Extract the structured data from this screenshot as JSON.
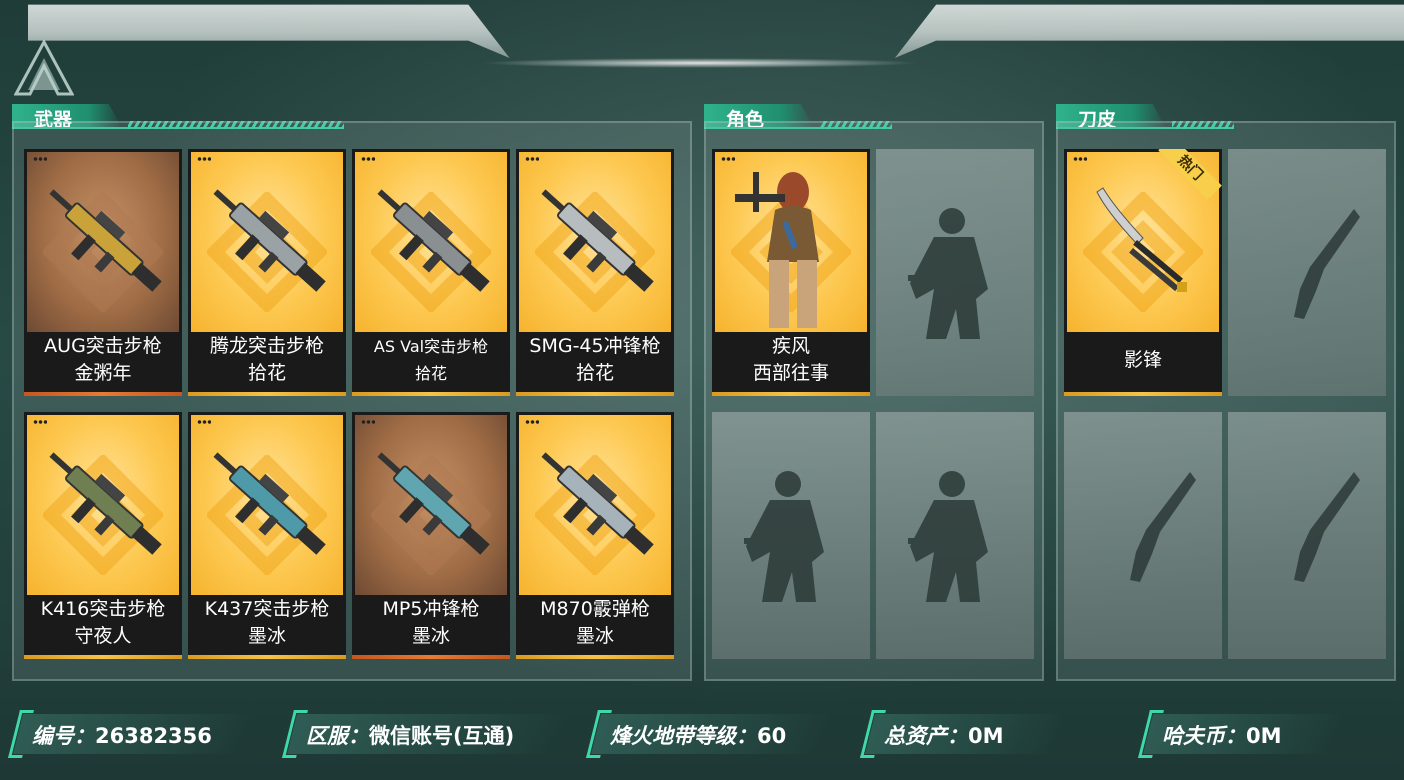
{
  "sections": {
    "weapons": {
      "title": "武器"
    },
    "characters": {
      "title": "角色"
    },
    "knives": {
      "title": "刀皮"
    }
  },
  "weapons": [
    {
      "line1": "AUG突击步枪",
      "line2": "金粥年",
      "rarity": "brown"
    },
    {
      "line1": "腾龙突击步枪",
      "line2": "拾花",
      "rarity": "gold"
    },
    {
      "line1": "AS Val突击步枪",
      "line2": "拾花",
      "rarity": "gold"
    },
    {
      "line1": "SMG-45冲锋枪",
      "line2": "拾花",
      "rarity": "gold"
    },
    {
      "line1": "K416突击步枪",
      "line2": "守夜人",
      "rarity": "gold"
    },
    {
      "line1": "K437突击步枪",
      "line2": "墨冰",
      "rarity": "gold"
    },
    {
      "line1": "MP5冲锋枪",
      "line2": "墨冰",
      "rarity": "brown"
    },
    {
      "line1": "M870霰弹枪",
      "line2": "墨冰",
      "rarity": "gold"
    }
  ],
  "characters": [
    {
      "line1": "疾风",
      "line2": "西部往事"
    }
  ],
  "knives": [
    {
      "line1": "影锋",
      "badge": "热门"
    }
  ],
  "info": {
    "id_label": "编号：",
    "id_value": "26382356",
    "server_label": "区服：",
    "server_value": "微信账号(互通)",
    "level_label": "烽火地带等级：",
    "level_value": "60",
    "assets_label": "总资产：",
    "assets_value": "0M",
    "coins_label": "哈夫币：",
    "coins_value": "0M"
  },
  "colors": {
    "accent": "#2fc598",
    "card_gold": "#fdc850",
    "card_brown": "#9c6a44"
  }
}
